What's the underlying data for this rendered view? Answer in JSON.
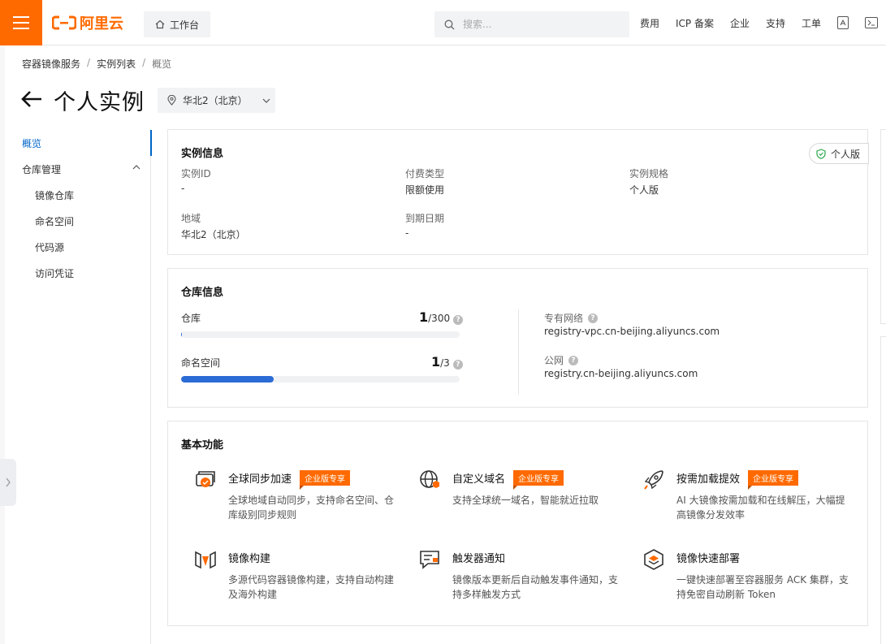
{
  "topbar": {
    "logo_text": "阿里云",
    "workbench_label": "工作台",
    "search_placeholder": "搜索...",
    "links": [
      "费用",
      "ICP 备案",
      "企业",
      "支持",
      "工单"
    ]
  },
  "breadcrumb": [
    "容器镜像服务",
    "实例列表",
    "概览"
  ],
  "page": {
    "title": "个人实例",
    "region": "华北2（北京）"
  },
  "sidenav": {
    "overview": "概览",
    "repo_mgmt": "仓库管理",
    "items": [
      "镜像仓库",
      "命名空间",
      "代码源",
      "访问凭证"
    ]
  },
  "instance_info": {
    "title": "实例信息",
    "badge": "个人版",
    "fields": [
      {
        "label": "实例ID",
        "value": "-"
      },
      {
        "label": "付费类型",
        "value": "限额使用"
      },
      {
        "label": "实例规格",
        "value": "个人版"
      },
      {
        "label": "地域",
        "value": "华北2（北京）"
      },
      {
        "label": "到期日期",
        "value": "-"
      }
    ]
  },
  "repo_info": {
    "title": "仓库信息",
    "repo": {
      "label": "仓库",
      "used": "1",
      "total": "/300",
      "fraction": 0.0033
    },
    "namespace": {
      "label": "命名空间",
      "used": "1",
      "total": "/3",
      "fraction": 0.333
    },
    "vpc": {
      "label": "专有网络",
      "value": "registry-vpc.cn-beijing.aliyuncs.com"
    },
    "public": {
      "label": "公网",
      "value": "registry.cn-beijing.aliyuncs.com"
    }
  },
  "features": {
    "title": "基本功能",
    "enterprise_tag": "企业版专享",
    "items": [
      {
        "name": "全球同步加速",
        "desc": "全球地域自动同步，支持命名空间、仓库级别同步规则"
      },
      {
        "name": "自定义域名",
        "desc": "支持全球统一域名，智能就近拉取"
      },
      {
        "name": "按需加载提效",
        "desc": "AI 大镜像按需加载和在线解压，大幅提高镜像分发效率"
      },
      {
        "name": "镜像构建",
        "desc": "多源代码容器镜像构建，支持自动构建及海外构建"
      },
      {
        "name": "触发器通知",
        "desc": "镜像版本更新后自动触发事件通知，支持多样触发方式"
      },
      {
        "name": "镜像快速部署",
        "desc": "一键快速部署至容器服务 ACK 集群，支持免密自动刷新 Token"
      }
    ]
  },
  "colors": {
    "brand": "#ff6a00",
    "accent": "#0064c8",
    "bar": "#2b6bd6"
  }
}
